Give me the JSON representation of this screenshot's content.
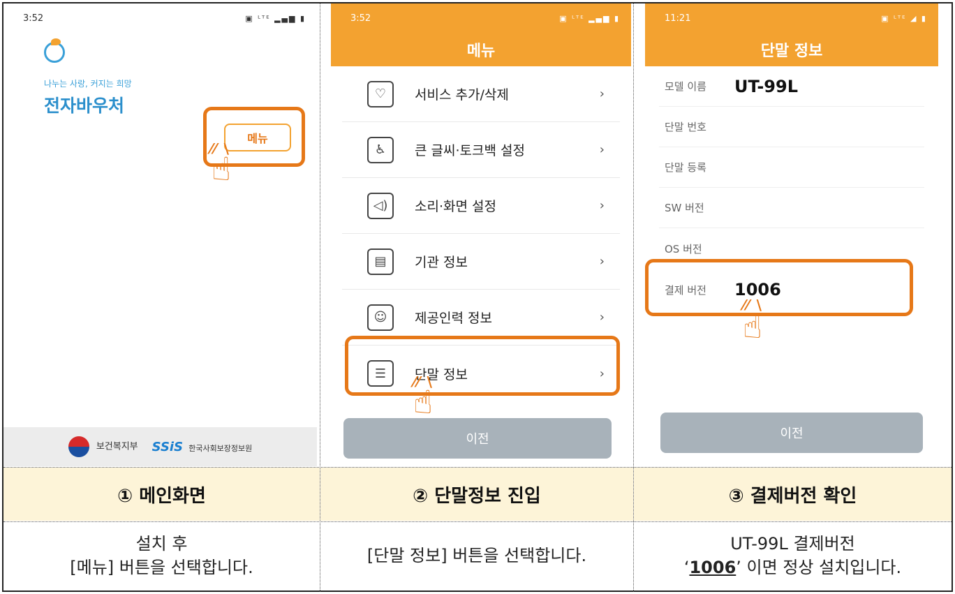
{
  "panel1": {
    "status_time": "3:52",
    "status_icons": "▣ ᴸᵀᴱ ▂▄▆ ▮",
    "slogan": "나누는 사랑, 커지는 희망",
    "brand": "전자바우처",
    "menu_button": "메뉴",
    "footer_org1": "보건복지부",
    "footer_org2_logo": "SSiS",
    "footer_org2": "한국사회보장정보원"
  },
  "panel2": {
    "status_time": "3:52",
    "status_icons": "▣ ᴸᵀᴱ ▂▄▆ ▮",
    "title": "메뉴",
    "items": [
      {
        "icon": "heart-plus-icon",
        "glyph": "♡",
        "label": "서비스 추가/삭제"
      },
      {
        "icon": "accessibility-icon",
        "glyph": "♿",
        "label": "큰 글씨·토크백 설정"
      },
      {
        "icon": "speaker-icon",
        "glyph": "◁)",
        "label": "소리·화면 설정"
      },
      {
        "icon": "building-icon",
        "glyph": "▤",
        "label": "기관 정보"
      },
      {
        "icon": "person-card-icon",
        "glyph": "☺",
        "label": "제공인력 정보"
      },
      {
        "icon": "device-icon",
        "glyph": "☰",
        "label": "단말 정보"
      }
    ],
    "chevron": "›",
    "prev_button": "이전"
  },
  "panel3": {
    "status_time": "11:21",
    "status_icons": "▣ ᴸᵀᴱ ◢ ▮",
    "title": "단말 정보",
    "rows": [
      {
        "key": "모델 이름",
        "value": "UT-99L"
      },
      {
        "key": "단말 번호",
        "value": ""
      },
      {
        "key": "단말 등록",
        "value": ""
      },
      {
        "key": "SW 버전",
        "value": ""
      },
      {
        "key": "OS 버전",
        "value": ""
      },
      {
        "key": "결제 버전",
        "value": "1006"
      }
    ],
    "prev_button": "이전"
  },
  "captions": {
    "step1": "① 메인화면",
    "step2": "② 단말정보 진입",
    "step3": "③ 결제버전 확인"
  },
  "descriptions": {
    "step1_line1": "설치 후",
    "step1_line2": "[메뉴] 버튼을 선택합니다.",
    "step2": "[단말 정보] 버튼을 선택합니다.",
    "step3_line1": "UT-99L 결제버전",
    "step3_quote_open": "‘",
    "step3_value": "1006",
    "step3_quote_close": "’",
    "step3_suffix": " 이면 정상 설치입니다."
  },
  "colors": {
    "accent_orange": "#f3a230",
    "highlight_orange": "#e67818",
    "caption_bg": "#fdf4d8",
    "button_gray": "#a8b2ba"
  }
}
